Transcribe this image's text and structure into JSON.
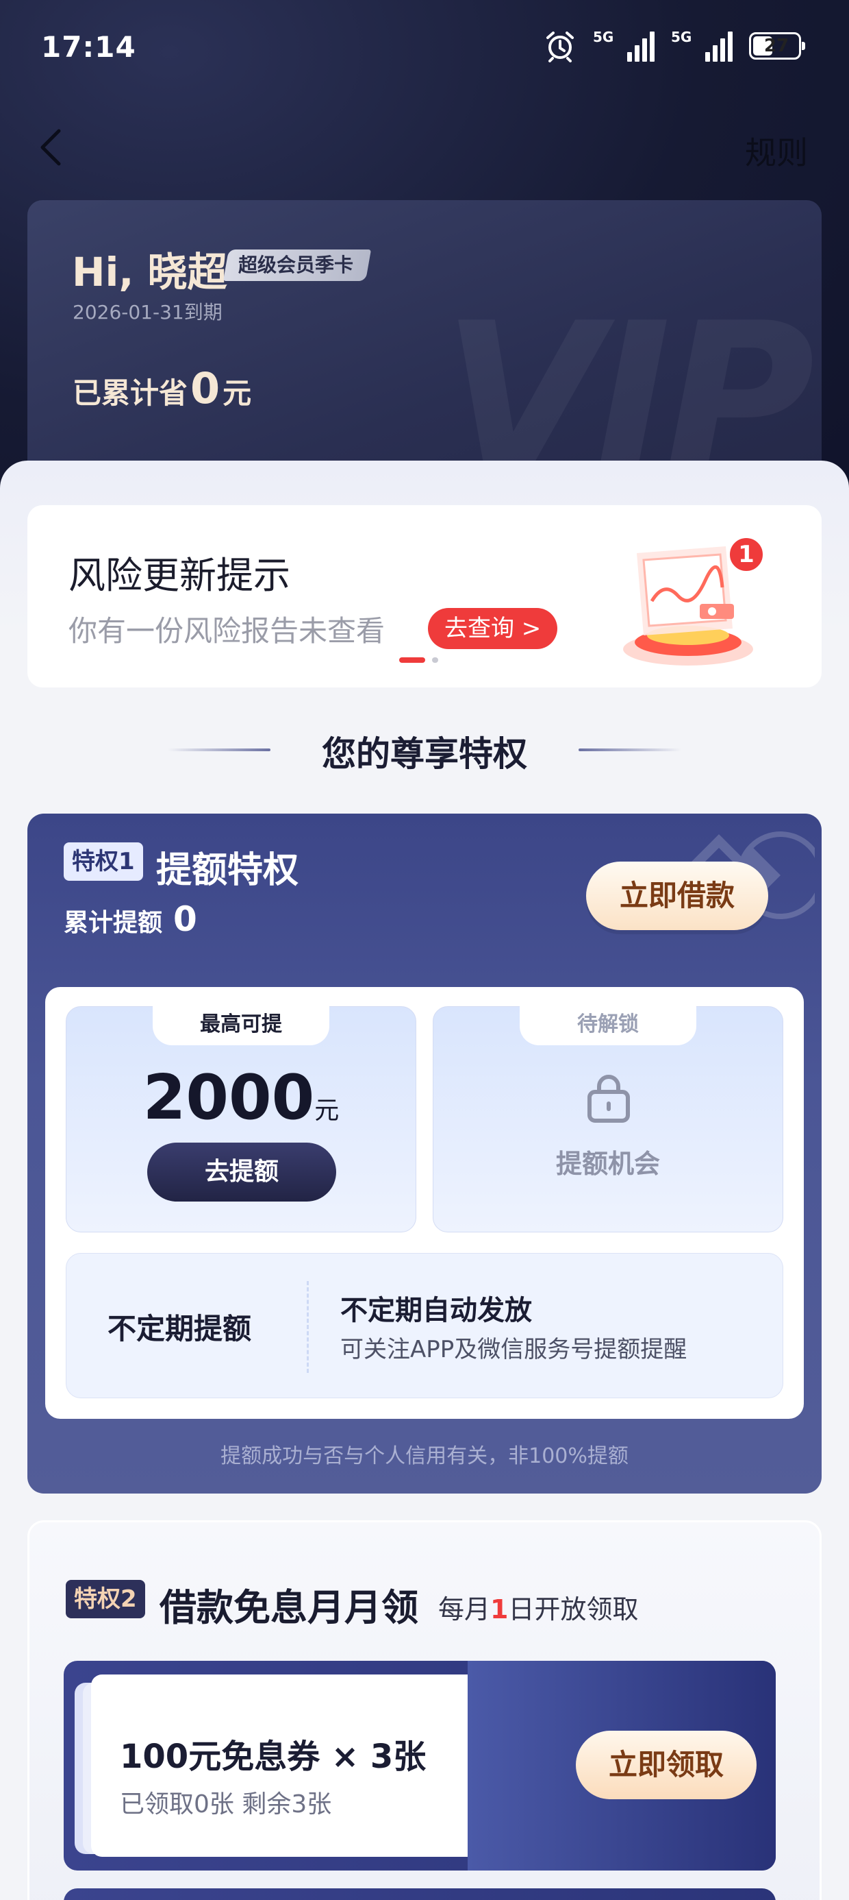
{
  "status_bar": {
    "time": "17:14",
    "signal1": "5G",
    "signal2": "5G",
    "battery": "27"
  },
  "nav": {
    "rules": "规则"
  },
  "vip": {
    "greeting": "Hi, 晓超",
    "badge": "超级会员季卡",
    "expire": "2026-01-31到期",
    "saved_prefix": "已累计省",
    "saved_amount": "0",
    "saved_suffix": "元",
    "watermark": "VIP"
  },
  "risk": {
    "title": "风险更新提示",
    "subtitle": "你有一份风险报告未查看",
    "button": "去查询 >",
    "badge_count": "1"
  },
  "section": {
    "title": "您的尊享特权"
  },
  "privilege1": {
    "tag": "特权1",
    "name": "提额特权",
    "accum_label": "累计提额",
    "accum_value": "0",
    "borrow_button": "立即借款",
    "tile_left": {
      "tab": "最高可提",
      "amount": "2000",
      "unit": "元",
      "button": "去提额"
    },
    "tile_right": {
      "tab": "待解锁",
      "label": "提额机会"
    },
    "irregular": {
      "left": "不定期提额",
      "title": "不定期自动发放",
      "desc": "可关注APP及微信服务号提额提醒"
    },
    "note": "提额成功与否与个人信用有关，非100%提额"
  },
  "privilege2": {
    "tag": "特权2",
    "name": "借款免息月月领",
    "note_prefix": "每月",
    "note_day": "1",
    "note_suffix": "日开放领取",
    "coupon": {
      "title": "100元免息券 × 3张",
      "sub": "已领取0张 剩余3张",
      "button": "立即领取"
    }
  },
  "colors": {
    "accent_red": "#ef3b3b",
    "privilege_blue": "#3c4688",
    "gold_text": "#7a3b15"
  }
}
